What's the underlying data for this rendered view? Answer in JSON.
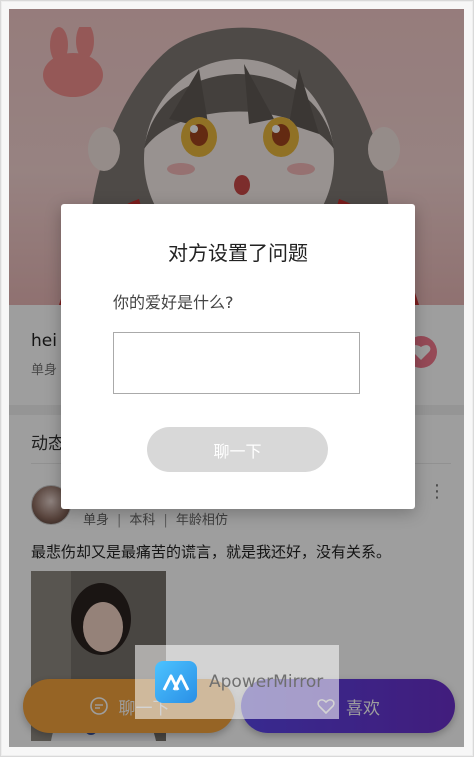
{
  "profile": {
    "name": "hei",
    "tags": "单身"
  },
  "feed": {
    "section_title": "动态",
    "post": {
      "tags": [
        "单身",
        "本科",
        "年龄相仿"
      ],
      "text": "最悲伤却又是最痛苦的谎言，就是我还好，没有关系。",
      "more_glyph": "⋮"
    }
  },
  "dialog": {
    "title": "对方设置了问题",
    "question": "你的爱好是什么?",
    "answer_value": "",
    "chat_label": "聊一下"
  },
  "actions": {
    "chat_label": "聊一下",
    "like_label": "喜欢"
  },
  "watermark": {
    "text": "ApowerMirror"
  },
  "colors": {
    "chat_button": "#f2a23c",
    "like_button": "#5a45e8",
    "dialog_button": "#d8d8d8",
    "overlay": "rgba(0,0,0,0.38)"
  }
}
